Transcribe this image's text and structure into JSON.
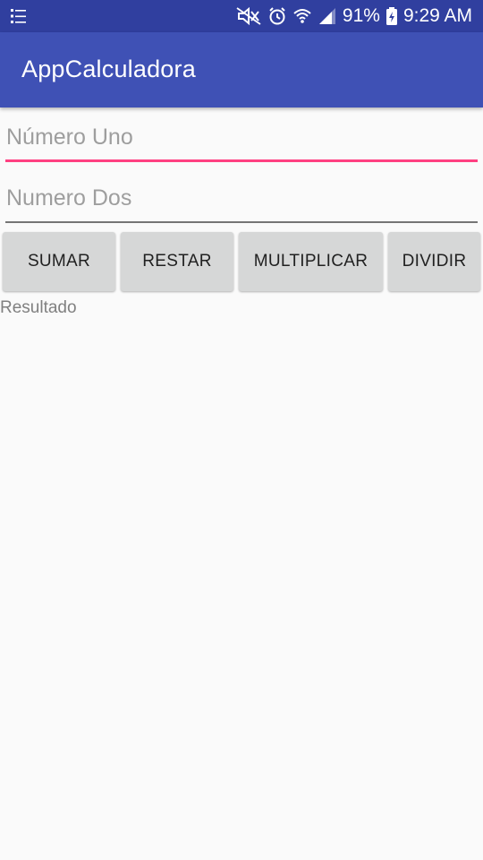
{
  "status_bar": {
    "battery_percent": "91%",
    "time": "9:29 AM",
    "icons": [
      "notification-list-icon",
      "mute-icon",
      "alarm-icon",
      "wifi-icon",
      "signal-icon",
      "battery-charging-icon"
    ]
  },
  "app_bar": {
    "title": "AppCalculadora",
    "color": "#3f51b5",
    "status_color": "#303f9f"
  },
  "form": {
    "numero_uno": {
      "value": "",
      "placeholder": "Número Uno",
      "focused": true,
      "accent": "#ff4081"
    },
    "numero_dos": {
      "value": "",
      "placeholder": "Numero Dos"
    }
  },
  "buttons": {
    "sumar": "SUMAR",
    "restar": "RESTAR",
    "multiplicar": "MULTIPLICAR",
    "dividir": "DIVIDIR"
  },
  "result": {
    "label": "Resultado"
  }
}
